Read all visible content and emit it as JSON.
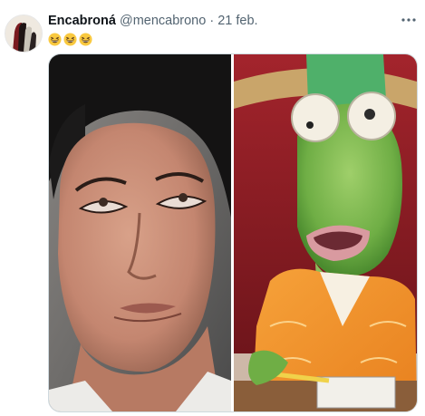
{
  "tweet": {
    "author_name": "Encabroná",
    "author_handle": "@mencabrono",
    "separator": "·",
    "date": "21 feb.",
    "body_emojis": [
      "grinning-squinting-face",
      "grinning-squinting-face",
      "grinning-squinting-face"
    ],
    "more_icon": "more-horizontal-icon"
  },
  "media": {
    "left_image": "woman-eye-roll-photo",
    "right_image": "green-lizard-character-photo"
  },
  "colors": {
    "text": "#0f1419",
    "secondary": "#536471",
    "border": "#cfd9de",
    "emoji_face": "#f9c940"
  }
}
